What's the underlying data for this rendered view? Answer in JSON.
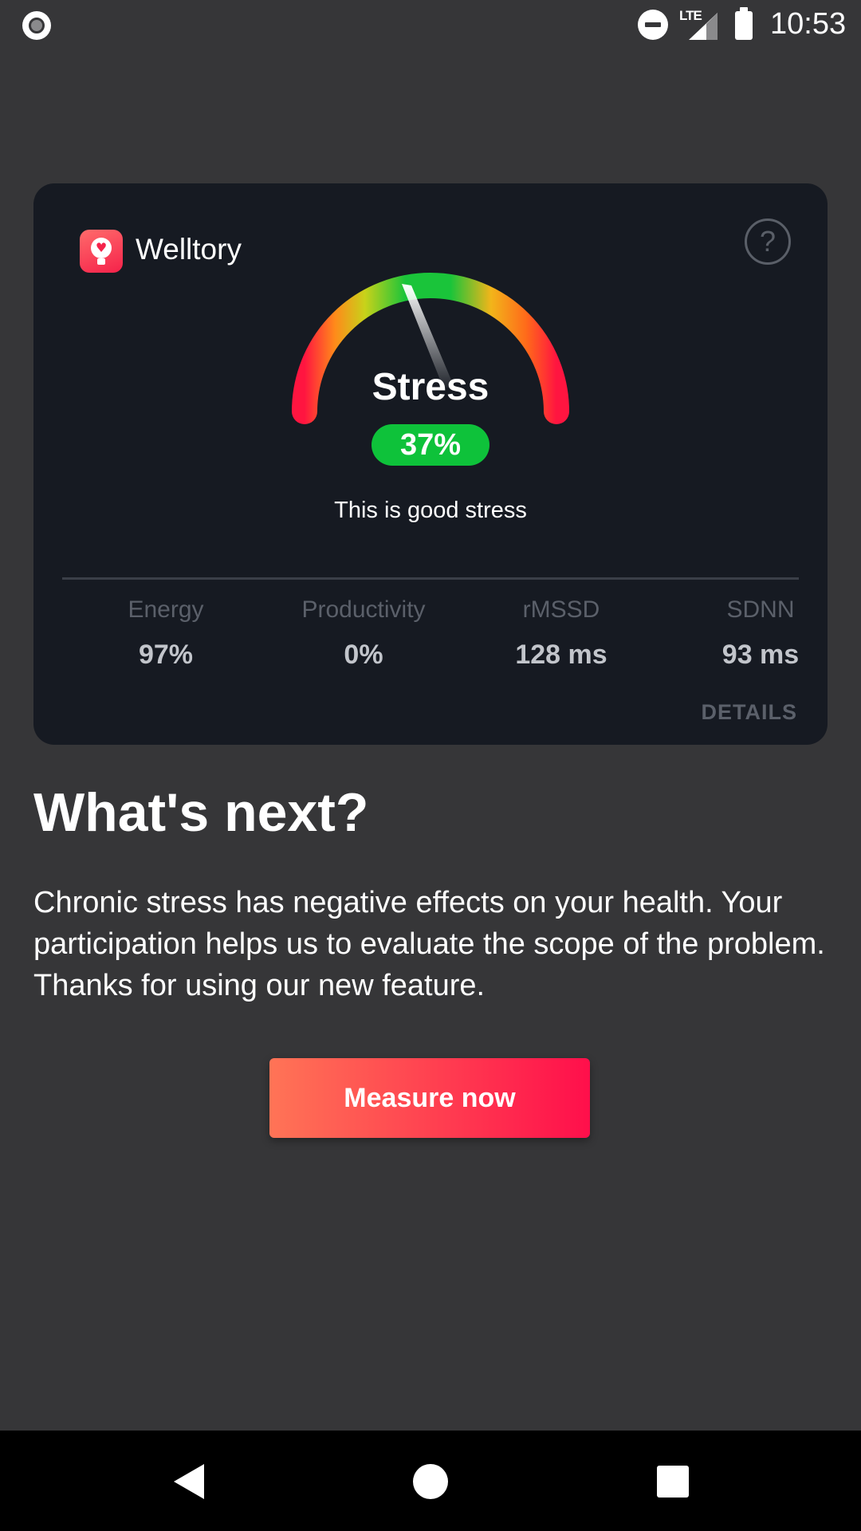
{
  "status_bar": {
    "time": "10:53",
    "network": "LTE"
  },
  "card": {
    "app_name": "Welltory",
    "help_label": "?",
    "gauge": {
      "title": "Stress",
      "percent": "37%",
      "value": 37,
      "caption": "This is good stress"
    },
    "metrics": [
      {
        "label": "Energy",
        "value": "97%"
      },
      {
        "label": "Productivity",
        "value": "0%"
      },
      {
        "label": "rMSSD",
        "value": "128 ms"
      },
      {
        "label": "SDNN",
        "value": "93 ms"
      }
    ],
    "details_label": "DETAILS"
  },
  "section": {
    "title": "What's next?",
    "body": "Chronic stress has negative effects on your health. Your participation helps us to evaluate the scope of the problem. Thanks for using our new feature."
  },
  "cta": {
    "label": "Measure now"
  },
  "colors": {
    "accent": "#ff1a4c",
    "badge_green": "#0ec23a",
    "card_bg": "#161a22",
    "page_bg": "#363638"
  }
}
